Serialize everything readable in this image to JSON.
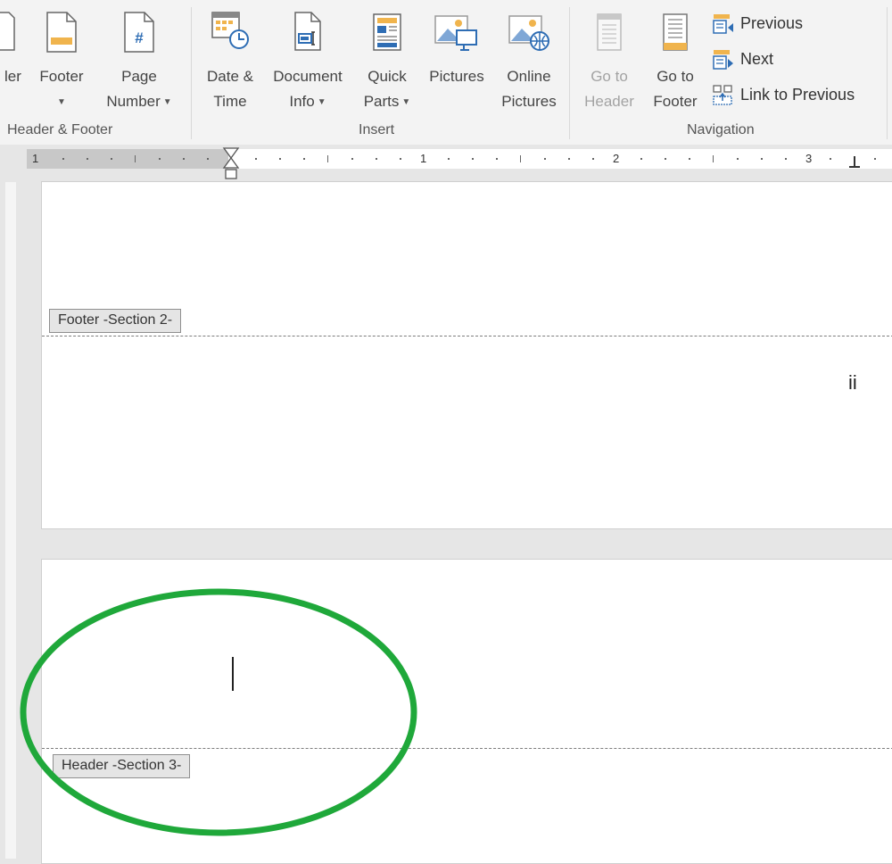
{
  "ribbon": {
    "header_fragment": "ler",
    "footer_label": "Footer",
    "page_number_label_1": "Page",
    "page_number_label_2": "Number",
    "date_time_label_1": "Date &",
    "date_time_label_2": "Time",
    "document_info_label_1": "Document",
    "document_info_label_2": "Info",
    "quick_parts_label_1": "Quick",
    "quick_parts_label_2": "Parts",
    "pictures_label": "Pictures",
    "online_pictures_label_1": "Online",
    "online_pictures_label_2": "Pictures",
    "go_to_header_label_1": "Go to",
    "go_to_header_label_2": "Header",
    "go_to_footer_label_1": "Go to",
    "go_to_footer_label_2": "Footer",
    "previous_label": "Previous",
    "next_label": "Next",
    "link_to_previous_label": "Link to Previous",
    "groups": {
      "header_footer": "Header & Footer",
      "insert": "Insert",
      "navigation": "Navigation"
    }
  },
  "ruler": {
    "numbers": [
      "1",
      "1",
      "2",
      "3"
    ]
  },
  "document": {
    "footer_tag": "Footer -Section 2-",
    "page_number_text": "ii",
    "header_tag": "Header -Section 3-"
  },
  "colors": {
    "annotation": "#1fa83a",
    "icon_blue": "#2e6db4",
    "icon_orange": "#f0b44d"
  }
}
